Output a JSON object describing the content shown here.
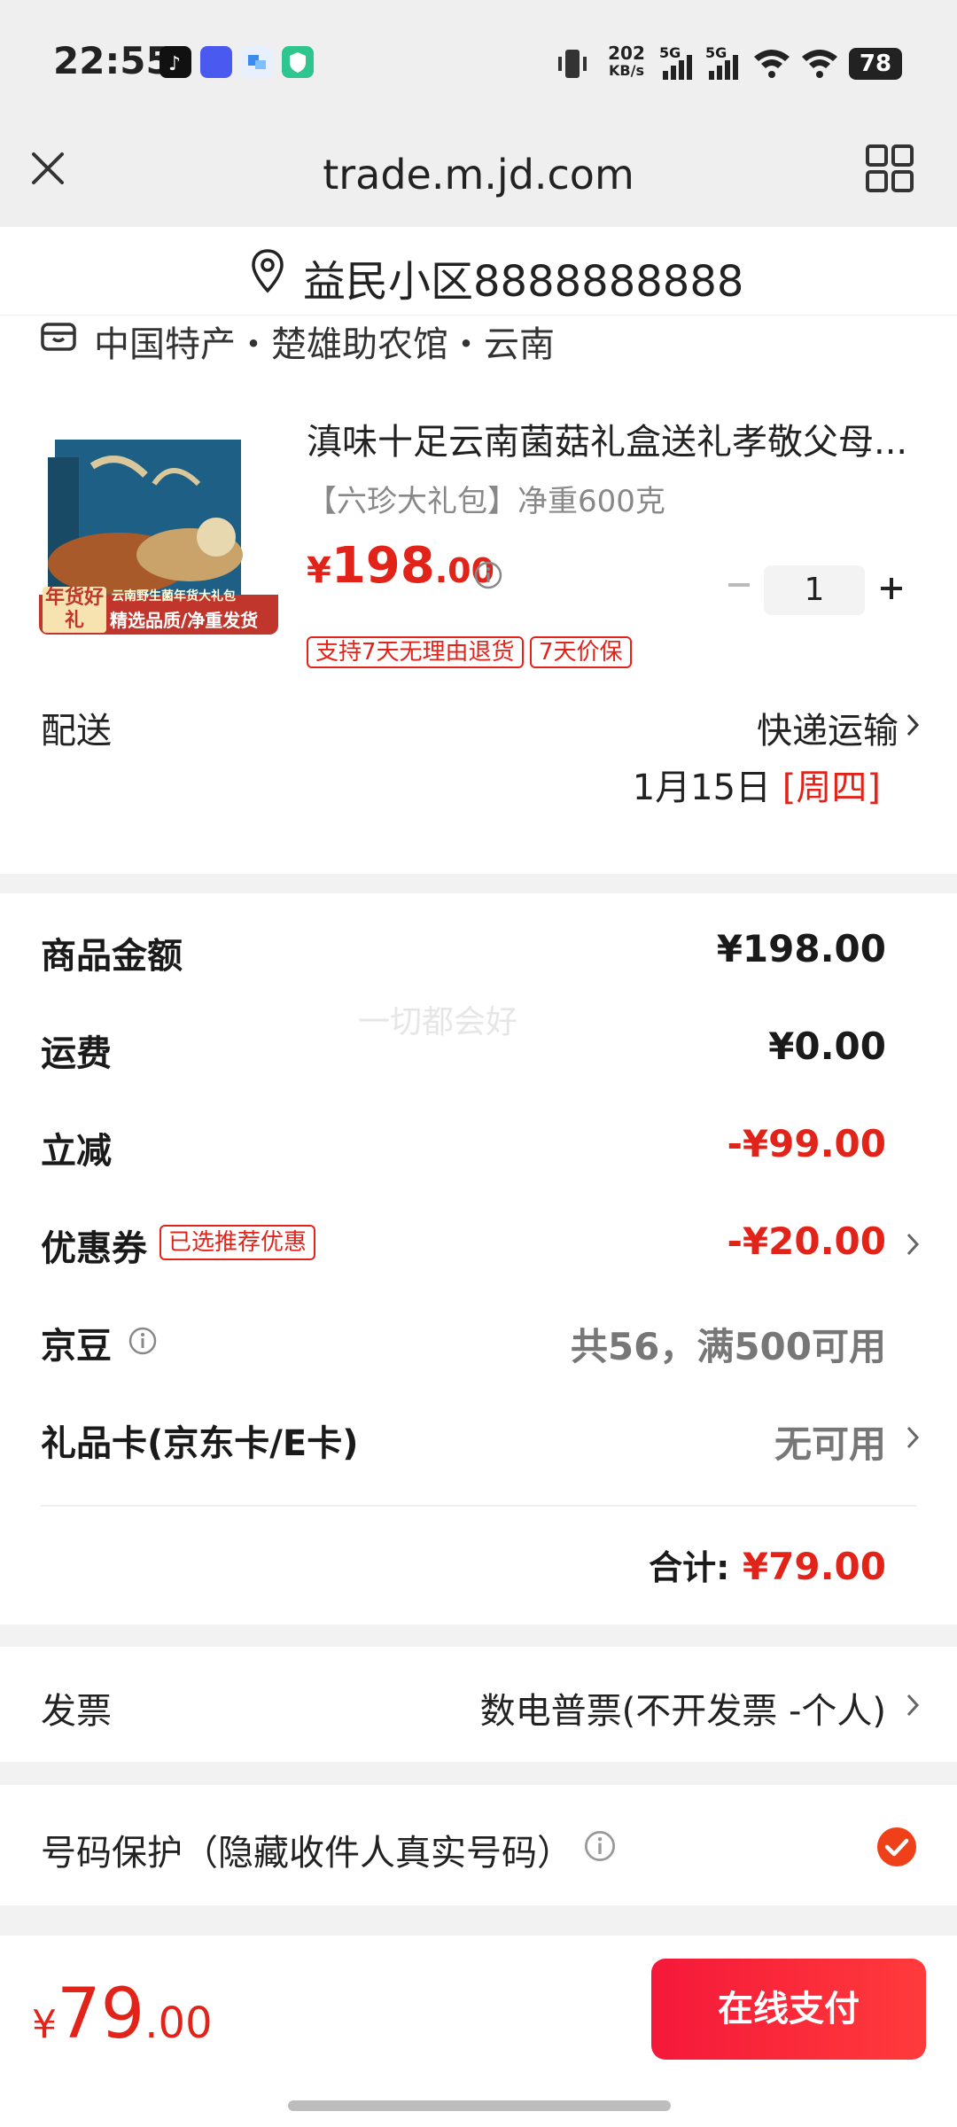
{
  "status_bar": {
    "time": "22:55",
    "net_speed_top": "202",
    "net_speed_bottom": "KB/s",
    "sim1": "5G",
    "sim2": "5G",
    "battery": "78"
  },
  "browser": {
    "url": "trade.m.jd.com"
  },
  "address": {
    "text": "益民小区8888888888"
  },
  "shop": {
    "name": "中国特产・楚雄助农馆・云南"
  },
  "product": {
    "title": "滇味十足云南菌菇礼盒送礼孝敬父母...",
    "spec": "【六珍大礼包】净重600克",
    "price_symbol": "¥",
    "price_int": "198",
    "price_dec": ".00",
    "quantity": "1",
    "tags": [
      "支持7天无理由退货",
      "7天价保"
    ],
    "image_badge": "年货好礼",
    "image_banner": "云南野生菌年货大礼包",
    "image_footer": "精选品质/净重发货"
  },
  "delivery": {
    "label": "配送",
    "method": "快递运输",
    "date": "1月15日",
    "weekday": "[周四]"
  },
  "summary": {
    "goods_label": "商品金额",
    "goods_value": "¥198.00",
    "shipping_label": "运费",
    "shipping_value": "¥0.00",
    "discount_label": "立减",
    "discount_value": "-¥99.00",
    "coupon_label": "优惠券",
    "coupon_tag": "已选推荐优惠",
    "coupon_value": "-¥20.00",
    "beans_label": "京豆",
    "beans_value": "共56，满500可用",
    "giftcard_label": "礼品卡(京东卡/E卡)",
    "giftcard_value": "无可用",
    "total_label": "合计:",
    "total_value": "¥79.00"
  },
  "watermark": "一切都会好",
  "invoice": {
    "label": "发票",
    "value": "数电普票(不开发票 -个人)"
  },
  "number_protect": {
    "label": "号码保护（隐藏收件人真实号码）",
    "checked": true
  },
  "footer": {
    "price_symbol": "¥",
    "price_int": "79",
    "price_dec": ".00",
    "pay_button": "在线支付"
  },
  "colors": {
    "accent_red": "#e2231a",
    "pay_button": "#f5183a"
  }
}
